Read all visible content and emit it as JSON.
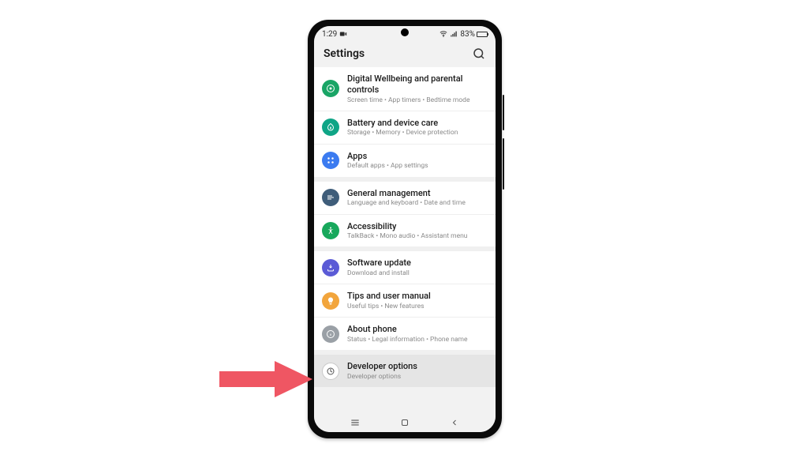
{
  "status": {
    "time": "1:29",
    "battery_pct": "83%"
  },
  "header": {
    "title": "Settings"
  },
  "groups": [
    {
      "rows": [
        {
          "key": "wellbeing",
          "title": "Digital Wellbeing and parental controls",
          "sub": "Screen time  •  App timers  •  Bedtime mode",
          "icon": "wellbeing-icon",
          "color": "#1aa566"
        },
        {
          "key": "battery",
          "title": "Battery and device care",
          "sub": "Storage  •  Memory  •  Device protection",
          "icon": "battery-care-icon",
          "color": "#0fa586"
        },
        {
          "key": "apps",
          "title": "Apps",
          "sub": "Default apps  •  App settings",
          "icon": "apps-icon",
          "color": "#3b7bf0"
        }
      ]
    },
    {
      "rows": [
        {
          "key": "general",
          "title": "General management",
          "sub": "Language and keyboard  •  Date and time",
          "icon": "general-icon",
          "color": "#3f5d7a"
        },
        {
          "key": "accessibility",
          "title": "Accessibility",
          "sub": "TalkBack  •  Mono audio  •  Assistant menu",
          "icon": "accessibility-icon",
          "color": "#18a85c"
        }
      ]
    },
    {
      "rows": [
        {
          "key": "swupdate",
          "title": "Software update",
          "sub": "Download and install",
          "icon": "update-icon",
          "color": "#5b5bd6"
        },
        {
          "key": "tips",
          "title": "Tips and user manual",
          "sub": "Useful tips  •  New features",
          "icon": "tips-icon",
          "color": "#f2a53c"
        },
        {
          "key": "about",
          "title": "About phone",
          "sub": "Status  •  Legal information  •  Phone name",
          "icon": "about-icon",
          "color": "#9aa0a6"
        }
      ]
    },
    {
      "rows": [
        {
          "key": "devopts",
          "title": "Developer options",
          "sub": "Developer options",
          "icon": "developer-icon",
          "color": "#ffffff",
          "highlight": true
        }
      ]
    }
  ],
  "annotation": {
    "target": "devopts",
    "arrow_color": "#ef5663"
  }
}
